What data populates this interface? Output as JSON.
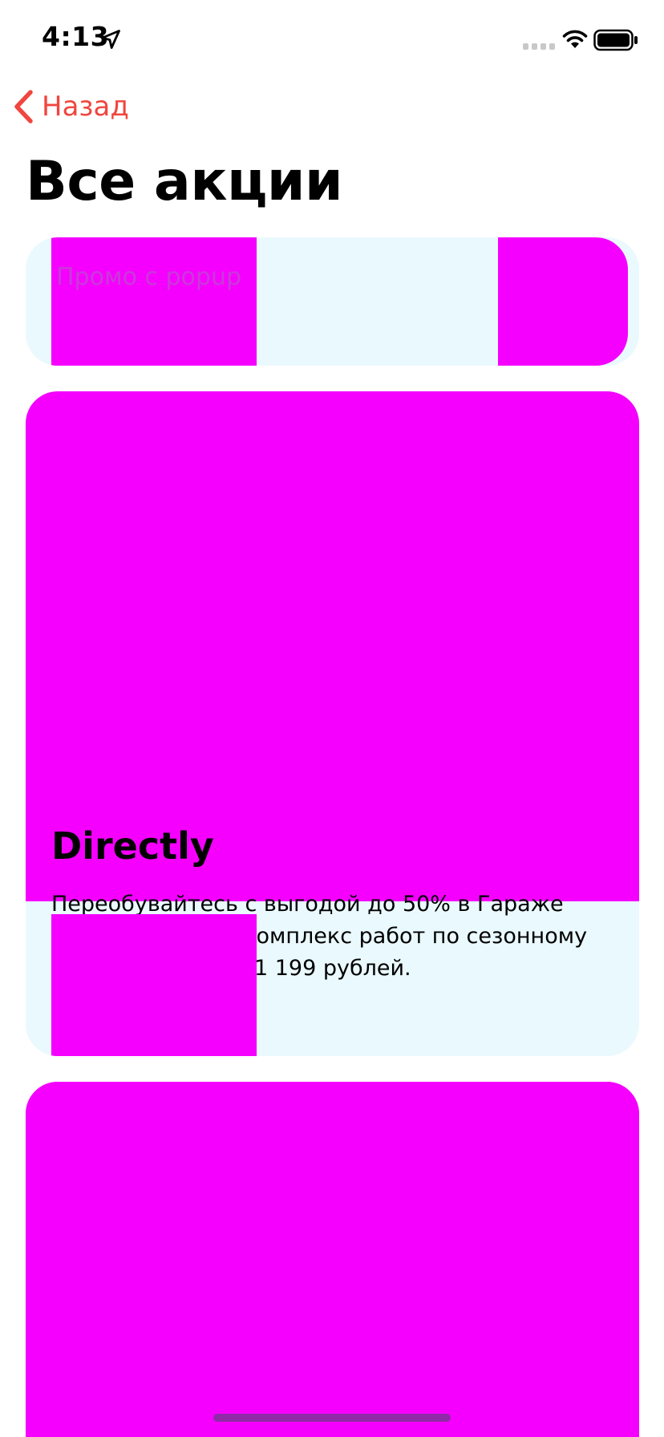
{
  "status_bar": {
    "time": "4:13",
    "icons": [
      "location-arrow-icon",
      "cellular-signal-icon",
      "wifi-icon",
      "battery-icon"
    ]
  },
  "navigation": {
    "back_label": "Назад",
    "back_icon": "chevron-left-icon",
    "accent_color": "#f0463f"
  },
  "page": {
    "title": "Все акции"
  },
  "promos": [
    {
      "faded_text": "Промо с popup"
    },
    {
      "title": "Directly",
      "description": "Переобувайтесь с выгодой до 50% в Гараже Яндекс. Полный комплекс работ по сезонному шиномонтажу от 1 199 рублей."
    }
  ],
  "colors": {
    "card_background": "#eaf9fd",
    "placeholder_image": "#f500ff",
    "home_indicator": "#8f2aa8"
  }
}
